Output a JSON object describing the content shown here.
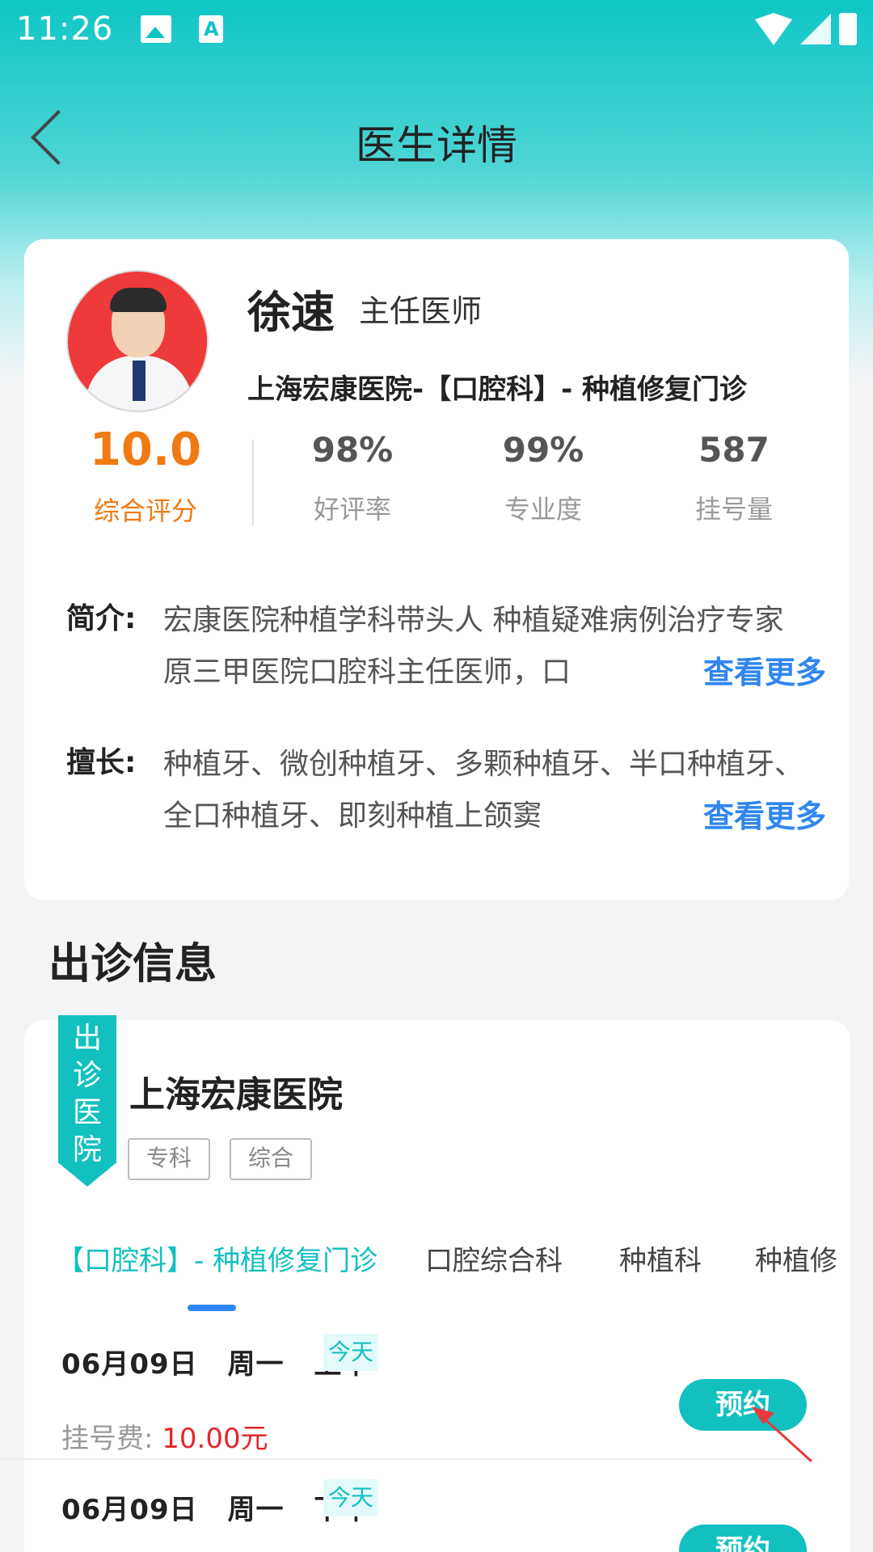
{
  "status_bar": {
    "time": "11:26"
  },
  "nav": {
    "title": "医生详情"
  },
  "doctor": {
    "name": "徐速",
    "title": "主任医师",
    "department": "上海宏康医院-【口腔科】- 种植修复门诊",
    "score": {
      "value": "10.0",
      "label": "综合评分"
    },
    "stats": [
      {
        "value": "98%",
        "label": "好评率"
      },
      {
        "value": "99%",
        "label": "专业度"
      },
      {
        "value": "587",
        "label": "挂号量"
      }
    ],
    "intro": {
      "label": "简介:",
      "text": "宏康医院种植学科带头人 种植疑难病例治疗专家 原三甲医院口腔科主任医师，口",
      "more": "查看更多"
    },
    "specialty": {
      "label": "擅长:",
      "text": "种植牙、微创种植牙、多颗种植牙、半口种植牙、全口种植牙、即刻种植上颌窦",
      "more": "查看更多"
    }
  },
  "visit_section": {
    "title": "出诊信息",
    "ribbon": [
      "出",
      "诊",
      "医",
      "院"
    ],
    "hospital_name": "上海宏康医院",
    "tags": [
      "专科",
      "综合"
    ],
    "tabs": [
      "【口腔科】- 种植修复门诊",
      "口腔综合科",
      "种植科",
      "种植修"
    ],
    "slots": [
      {
        "date": "06月09日",
        "weekday": "周一",
        "period": "上午",
        "badge": "今天",
        "fee_label": "挂号费:",
        "fee_value": "10.00元",
        "button": "预约"
      },
      {
        "date": "06月09日",
        "weekday": "周一",
        "period": "下午",
        "badge": "今天",
        "button": "预约"
      }
    ]
  },
  "colors": {
    "accent": "#12c0c0",
    "link": "#2f86f0",
    "score": "#f07a14",
    "fee": "#e4262a"
  }
}
